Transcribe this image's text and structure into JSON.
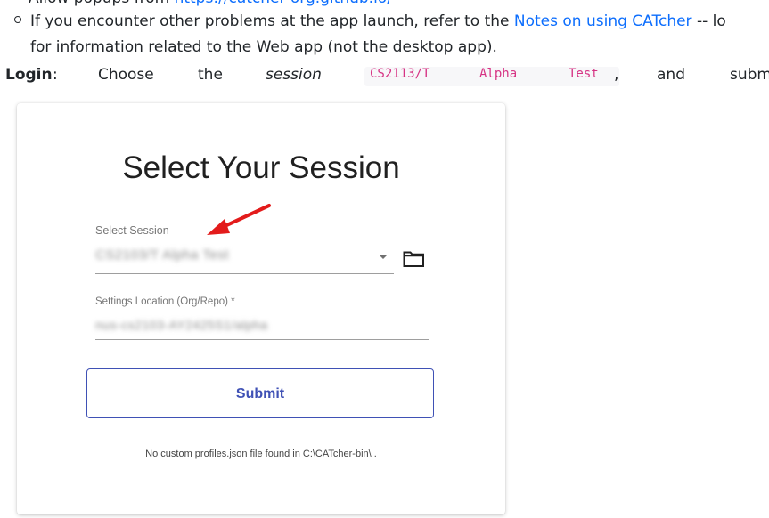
{
  "doc": {
    "bullet_top": {
      "text": "Allow popups from ",
      "link": "https://catcher-org.github.io/"
    },
    "bullet": {
      "text_before": "If you encounter other problems at the app launch, refer to the ",
      "link": "Notes on using CATcher",
      "text_after": " -- lo",
      "continuation": "for information related to the Web app (not the desktop app)."
    },
    "login": {
      "label": "Login",
      "colon": ":",
      "w1": "Choose",
      "w2": "the",
      "w3": "session",
      "code_parts": [
        "CS2113/T",
        "Alpha",
        "Test"
      ],
      "comma": ",",
      "w4": "and",
      "w5": "subm"
    }
  },
  "card": {
    "title": "Select Your Session",
    "session_field": {
      "label": "Select Session",
      "value": "CS2103/T Alpha Test"
    },
    "settings_field": {
      "label": "Settings Location (Org/Repo) *",
      "value": "nus-cs2103-AY2425S1/alpha"
    },
    "submit_label": "Submit",
    "footnote": "No custom profiles.json file found in C:\\CATcher-bin\\ ."
  },
  "icons": {
    "dropdown": "chevron-down-icon",
    "folder": "folder-icon",
    "annotation": "red-arrow-icon"
  },
  "colors": {
    "link": "#0d6efd",
    "code": "#d63384",
    "accent": "#3f51b5",
    "annotation": "#e31b1b"
  }
}
